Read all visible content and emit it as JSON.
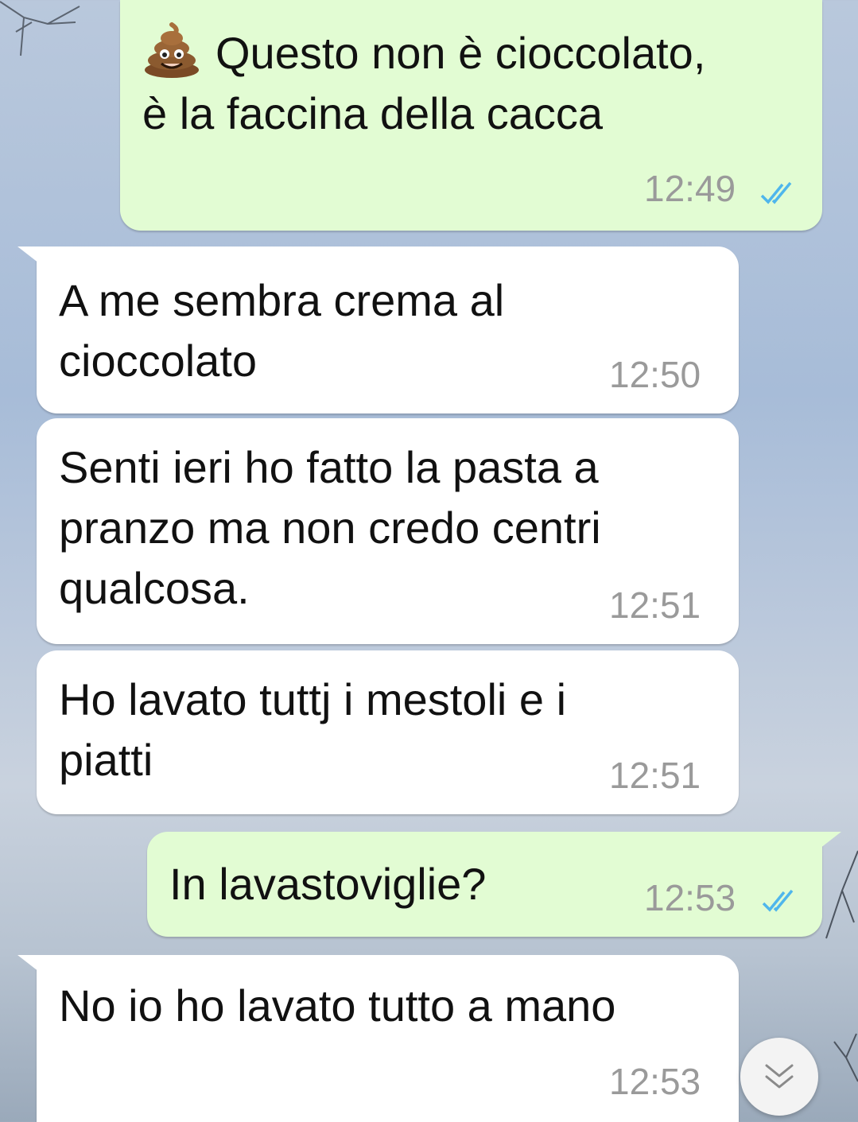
{
  "chat": {
    "messages": [
      {
        "direction": "outgoing",
        "emoji": "pile-of-poo",
        "text": "Questo non è cioccolato,\nè la faccina della cacca",
        "time": "12:49",
        "status": "read"
      },
      {
        "direction": "incoming",
        "text": "A me sembra crema al\ncioccolato",
        "time": "12:50"
      },
      {
        "direction": "incoming",
        "text": "Senti ieri ho fatto la pasta a\npranzo ma non credo centri\nqualcosa.",
        "time": "12:51"
      },
      {
        "direction": "incoming",
        "text": "Ho lavato tuttj i mestoli e i\npiatti",
        "time": "12:51"
      },
      {
        "direction": "outgoing",
        "text": "In lavastoviglie?",
        "time": "12:53",
        "status": "read"
      },
      {
        "direction": "incoming",
        "text": "No io ho lavato tutto a mano",
        "time": "12:53"
      }
    ]
  },
  "colors": {
    "outgoing_bubble": "#e2fcd3",
    "incoming_bubble": "#ffffff",
    "read_ticks": "#4fb6ec",
    "timestamp": "#9a9a9a"
  },
  "icons": {
    "read_receipt": "double-check-icon",
    "scroll_down": "chevron-double-down-icon",
    "emoji": "pile-of-poo-icon"
  }
}
